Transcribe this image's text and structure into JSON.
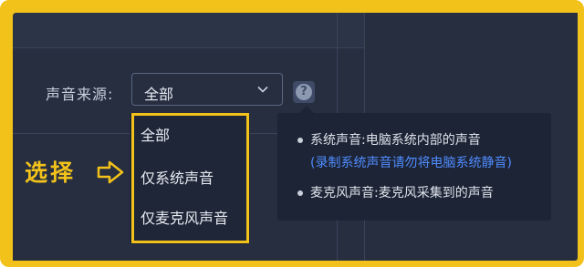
{
  "audio_source": {
    "label": "声音来源:",
    "selected": "全部",
    "help_symbol": "?",
    "options": [
      "全部",
      "仅系统声音",
      "仅麦克风声音"
    ]
  },
  "annotation": {
    "text": "选择",
    "highlight_color": "#f3c21a"
  },
  "tooltip": {
    "items": [
      {
        "text": "系统声音:电脑系统内部的声音",
        "note": "(录制系统声音请勿将电脑系统静音)"
      },
      {
        "text": "麦克风声音:麦克风采集到的声音"
      }
    ]
  },
  "icons": {
    "dropdown": "chevron-down-icon",
    "help": "question-icon",
    "annotation_arrow": "right-arrow-icon"
  },
  "colors": {
    "accent": "#f3c21a",
    "background": "#262e40",
    "link": "#4f8cff"
  }
}
